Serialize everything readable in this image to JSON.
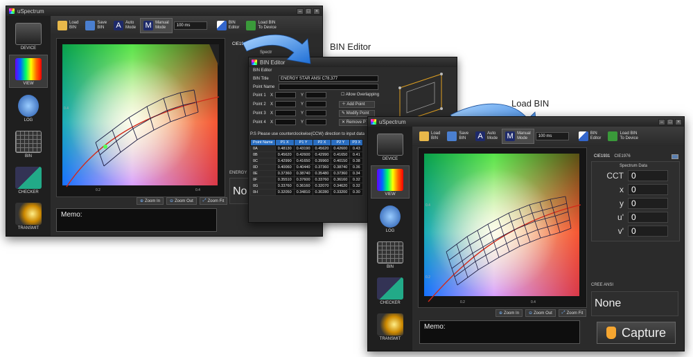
{
  "app_title": "uSpectrum",
  "labels": {
    "bin_editor_caption": "BIN Editor",
    "load_bin_caption": "Load BIN"
  },
  "sidebar": {
    "items": [
      {
        "label": "DEVICE",
        "icon": "usb-device-icon"
      },
      {
        "label": "VIEW",
        "icon": "spectrum-view-icon"
      },
      {
        "label": "LOG",
        "icon": "log-refresh-icon"
      },
      {
        "label": "BIN",
        "icon": "bin-grid-icon"
      },
      {
        "label": "CHECKER",
        "icon": "checker-icon"
      },
      {
        "label": "TRANSMIT",
        "icon": "transmit-bulb-icon"
      }
    ]
  },
  "toolbar": {
    "load_bin": "Load\nBIN",
    "save_bin": "Save\nBIN",
    "auto_mode": "Auto\nMode",
    "manual_mode": "Manual\nMode",
    "time_value": "100 ms",
    "bin_editor": "BIN\nEditor",
    "load_bin_device": "Load BIN\nTo Device"
  },
  "cie": {
    "tab1931": "CIE1931",
    "tab1976": "CIE1976",
    "spectrum_data_title": "Spectrum Data",
    "spectrum_short": "Spectr",
    "rows": [
      {
        "label": "CCT",
        "value": "0"
      },
      {
        "label": "x",
        "value": "0"
      },
      {
        "label": "y",
        "value": "0"
      },
      {
        "label": "u'",
        "value": "0"
      },
      {
        "label": "v'",
        "value": "0"
      }
    ]
  },
  "bin_result": {
    "caption": "CREE ANSI",
    "value": "None",
    "caption_left": "ENERGY S",
    "value_left": "No"
  },
  "zoom": {
    "in": "Zoom In",
    "out": "Zoom Out",
    "fit": "Zoom Fit"
  },
  "memo_label": "Memo:",
  "capture_label": "Capture",
  "plot_ticks": {
    "y1": "0.4",
    "y2": "0.2",
    "x1": "0.2",
    "x2": "0.4",
    "right_y": "0.4"
  },
  "bin_editor": {
    "window_title": "BIN Editor",
    "group_label": "BIN Editor",
    "bin_title_label": "BIN Title",
    "bin_title_value": "ENERGY STAR ANSI C78.377",
    "point_name_label": "Point Name",
    "point_rows": [
      "Point 1",
      "Point 2",
      "Point 3",
      "Point 4"
    ],
    "x_label": "X",
    "y_label": "Y",
    "allow_overlapping": "Allow Overlapping",
    "add_point": "Add Point",
    "modify_point": "Modify Point",
    "remove_point": "Remove P",
    "note": "P.S Please use counterclockwise(CCW) direction to input data",
    "table_headers": [
      "Point Name",
      "P1 X",
      "P1 Y",
      "P2 X",
      "P2 Y",
      "P3 X"
    ],
    "table_rows": [
      [
        "0A",
        "0.48130",
        "0.43190",
        "0.45620",
        "0.42600",
        "0.43"
      ],
      [
        "0B",
        "0.45620",
        "0.42600",
        "0.42990",
        "0.41650",
        "0.41"
      ],
      [
        "0C",
        "0.42990",
        "0.41650",
        "0.39960",
        "0.40150",
        "0.38"
      ],
      [
        "0D",
        "0.40060",
        "0.40440",
        "0.37360",
        "0.38740",
        "0.36"
      ],
      [
        "0E",
        "0.37360",
        "0.38740",
        "0.35480",
        "0.37360",
        "0.34"
      ],
      [
        "0F",
        "0.35510",
        "0.37600",
        "0.33760",
        "0.36160",
        "0.32"
      ],
      [
        "0G",
        "0.33760",
        "0.36160",
        "0.32070",
        "0.34620",
        "0.32"
      ],
      [
        "0H",
        "0.32050",
        "0.34810",
        "0.30280",
        "0.33200",
        "0.30"
      ]
    ]
  },
  "colors": {
    "accent_arrow": "#2b7fe0",
    "header_blue": "#2a6ec1",
    "window_bg": "#2b2b2b",
    "planckian": "#d22a1a",
    "bin_grid": "#1a1a40"
  }
}
